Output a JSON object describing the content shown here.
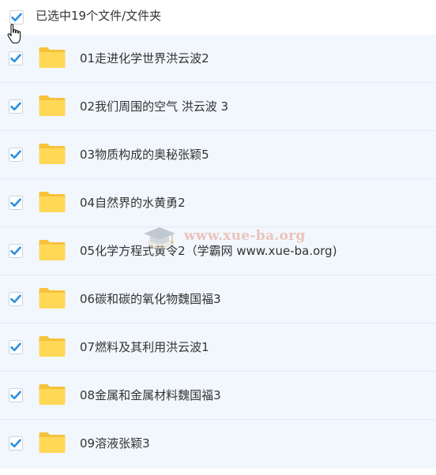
{
  "header": {
    "selection_text": "已选中19个文件/文件夹",
    "select_all_checked": true
  },
  "items": [
    {
      "label": "01走进化学世界洪云波2",
      "checked": true,
      "icon": "folder-icon"
    },
    {
      "label": "02我们周围的空气 洪云波 3",
      "checked": true,
      "icon": "folder-icon"
    },
    {
      "label": "03物质构成的奥秘张颖5",
      "checked": true,
      "icon": "folder-icon"
    },
    {
      "label": "04自然界的水黄勇2",
      "checked": true,
      "icon": "folder-icon"
    },
    {
      "label": "05化学方程式黄令2（学霸网 www.xue-ba.org)",
      "checked": true,
      "icon": "folder-icon"
    },
    {
      "label": "06碳和碳的氧化物魏国福3",
      "checked": true,
      "icon": "folder-icon"
    },
    {
      "label": "07燃料及其利用洪云波1",
      "checked": true,
      "icon": "folder-icon"
    },
    {
      "label": "08金属和金属材料魏国福3",
      "checked": true,
      "icon": "folder-icon"
    },
    {
      "label": "09溶液张颖3",
      "checked": true,
      "icon": "folder-icon"
    }
  ],
  "watermark": {
    "text": "www.xue-ba.org"
  },
  "colors": {
    "checkbox": "#2b8fe3",
    "folder": "#ffd34d",
    "row_bg": "#f2f7fd",
    "row_border": "#dfe9f7",
    "text": "#333333"
  }
}
